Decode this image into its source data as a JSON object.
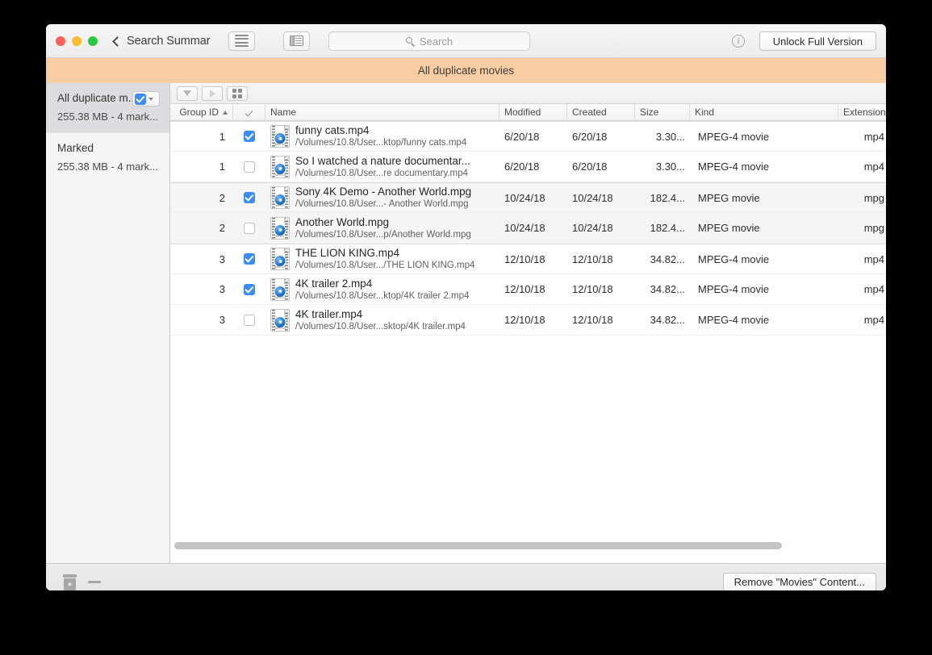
{
  "window": {
    "traffic_lights": [
      "close",
      "minimize",
      "zoom"
    ],
    "back_label": "Search Summar",
    "banner_title": "All duplicate movies",
    "accent_banner_color": "#f9cda3",
    "accent_checkbox_color": "#3b8cf5"
  },
  "toolbar": {
    "list_view_icon": "list-lines-icon",
    "panel_view_icon": "panel-view-icon",
    "search_placeholder": "Search",
    "search_value": "",
    "search_icon": "search-icon",
    "info_icon": "info-icon",
    "info_glyph": "i",
    "unlock_label": "Unlock Full Version"
  },
  "sidebar": {
    "items": [
      {
        "title": "All duplicate m...",
        "subtitle": "255.38 MB - 4 mark...",
        "selected": true,
        "has_mark_control": true,
        "mark_checked": true
      },
      {
        "title": "Marked",
        "subtitle": "255.38 MB - 4 mark...",
        "selected": false,
        "has_mark_control": false,
        "mark_checked": false
      }
    ]
  },
  "table_toolbar": {
    "collapse_all_icon": "triangle-down-icon",
    "expand_all_icon": "triangle-right-icon",
    "grid_view_icon": "grid-squares-icon"
  },
  "table": {
    "columns": [
      {
        "key": "group",
        "label": "Group ID",
        "sorted": "asc",
        "sort_icon": "caret-up-icon"
      },
      {
        "key": "check",
        "label": "",
        "icon": "checkmark-icon"
      },
      {
        "key": "name",
        "label": "Name"
      },
      {
        "key": "modified",
        "label": "Modified"
      },
      {
        "key": "created",
        "label": "Created"
      },
      {
        "key": "size",
        "label": "Size"
      },
      {
        "key": "kind",
        "label": "Kind"
      },
      {
        "key": "extension",
        "label": "Extension"
      }
    ],
    "rows": [
      {
        "group": "1",
        "checked": true,
        "name": "funny cats.mp4",
        "path": "/Volumes/10.8/User...ktop/funny cats.mp4",
        "modified": "6/20/18",
        "created": "6/20/18",
        "size": "3.30...",
        "kind": "MPEG-4 movie",
        "extension": "mp4",
        "icon_label": "MPEG4",
        "icon": "movie-file-icon",
        "band": false,
        "group_start": true
      },
      {
        "group": "1",
        "checked": false,
        "name": "So I watched a nature documentar...",
        "path": "/Volumes/10.8/User...re documentary.mp4",
        "modified": "6/20/18",
        "created": "6/20/18",
        "size": "3.30...",
        "kind": "MPEG-4 movie",
        "extension": "mp4",
        "icon_label": "MPEG4",
        "icon": "movie-file-icon",
        "band": false,
        "group_start": false
      },
      {
        "group": "2",
        "checked": true,
        "name": "Sony 4K Demo - Another World.mpg",
        "path": "/Volumes/10.8/User...- Another World.mpg",
        "modified": "10/24/18",
        "created": "10/24/18",
        "size": "182.4...",
        "kind": "MPEG movie",
        "extension": "mpg",
        "icon_label": "MPEG",
        "icon": "movie-file-icon",
        "band": true,
        "group_start": true
      },
      {
        "group": "2",
        "checked": false,
        "name": "Another World.mpg",
        "path": "/Volumes/10.8/User...p/Another World.mpg",
        "modified": "10/24/18",
        "created": "10/24/18",
        "size": "182.4...",
        "kind": "MPEG movie",
        "extension": "mpg",
        "icon_label": "MPEG",
        "icon": "movie-file-icon",
        "band": true,
        "group_start": false
      },
      {
        "group": "3",
        "checked": true,
        "name": "THE LION KING.mp4",
        "path": "/Volumes/10.8/User.../THE LION KING.mp4",
        "modified": "12/10/18",
        "created": "12/10/18",
        "size": "34.82...",
        "kind": "MPEG-4 movie",
        "extension": "mp4",
        "icon_label": "MPEG4",
        "icon": "movie-file-icon",
        "band": false,
        "group_start": true
      },
      {
        "group": "3",
        "checked": true,
        "name": "4K trailer 2.mp4",
        "path": "/Volumes/10.8/User...ktop/4K trailer 2.mp4",
        "modified": "12/10/18",
        "created": "12/10/18",
        "size": "34.82...",
        "kind": "MPEG-4 movie",
        "extension": "mp4",
        "icon_label": "MPEG4",
        "icon": "movie-file-icon",
        "band": false,
        "group_start": false
      },
      {
        "group": "3",
        "checked": false,
        "name": "4K trailer.mp4",
        "path": "/Volumes/10.8/User...sktop/4K trailer.mp4",
        "modified": "12/10/18",
        "created": "12/10/18",
        "size": "34.82...",
        "kind": "MPEG-4 movie",
        "extension": "mp4",
        "icon_label": "MPEG4",
        "icon": "movie-file-icon",
        "band": false,
        "group_start": false
      }
    ]
  },
  "bottom": {
    "trash_icon": "trash-can-icon",
    "dash_icon": "minus-icon",
    "remove_label": "Remove \"Movies\" Content..."
  }
}
